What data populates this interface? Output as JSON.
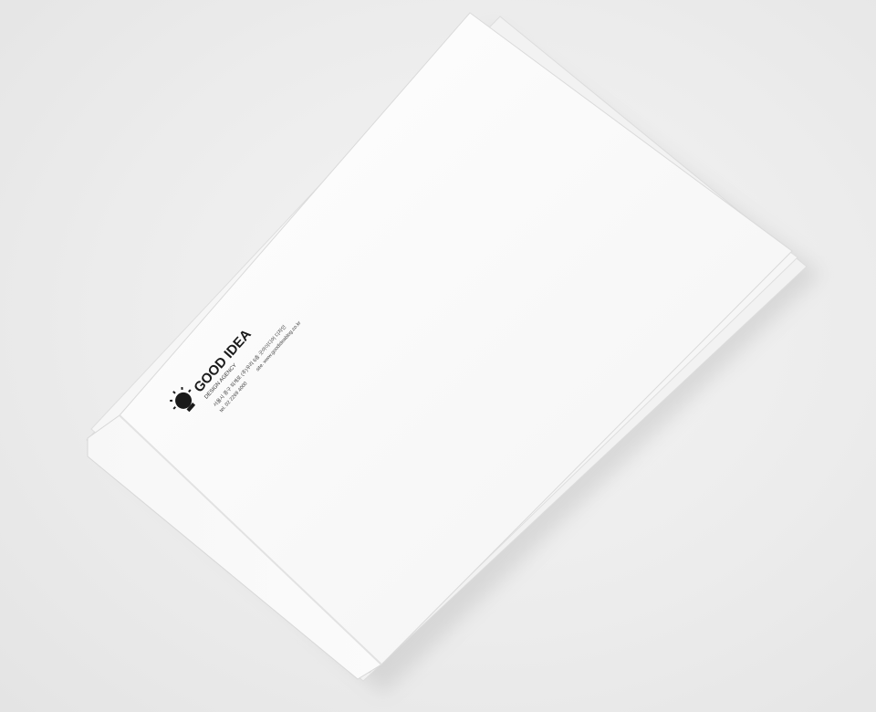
{
  "scene": {
    "subject": "white envelopes",
    "colors": {
      "background": "#ececec",
      "paper": "#fafafa",
      "ink": "#1a1a1a"
    }
  },
  "logo": {
    "icon": "lightbulb-head-icon",
    "brand": "GOOD IDEA",
    "tagline": "DESIGN AGENCY"
  },
  "contact": {
    "address": "서울시 중구 퇴계로 (주)우리 6층 굿아이디어 디자인",
    "tel": "tel. 02 2269 4000",
    "web": "site. www.goodideablog.co.kr"
  }
}
